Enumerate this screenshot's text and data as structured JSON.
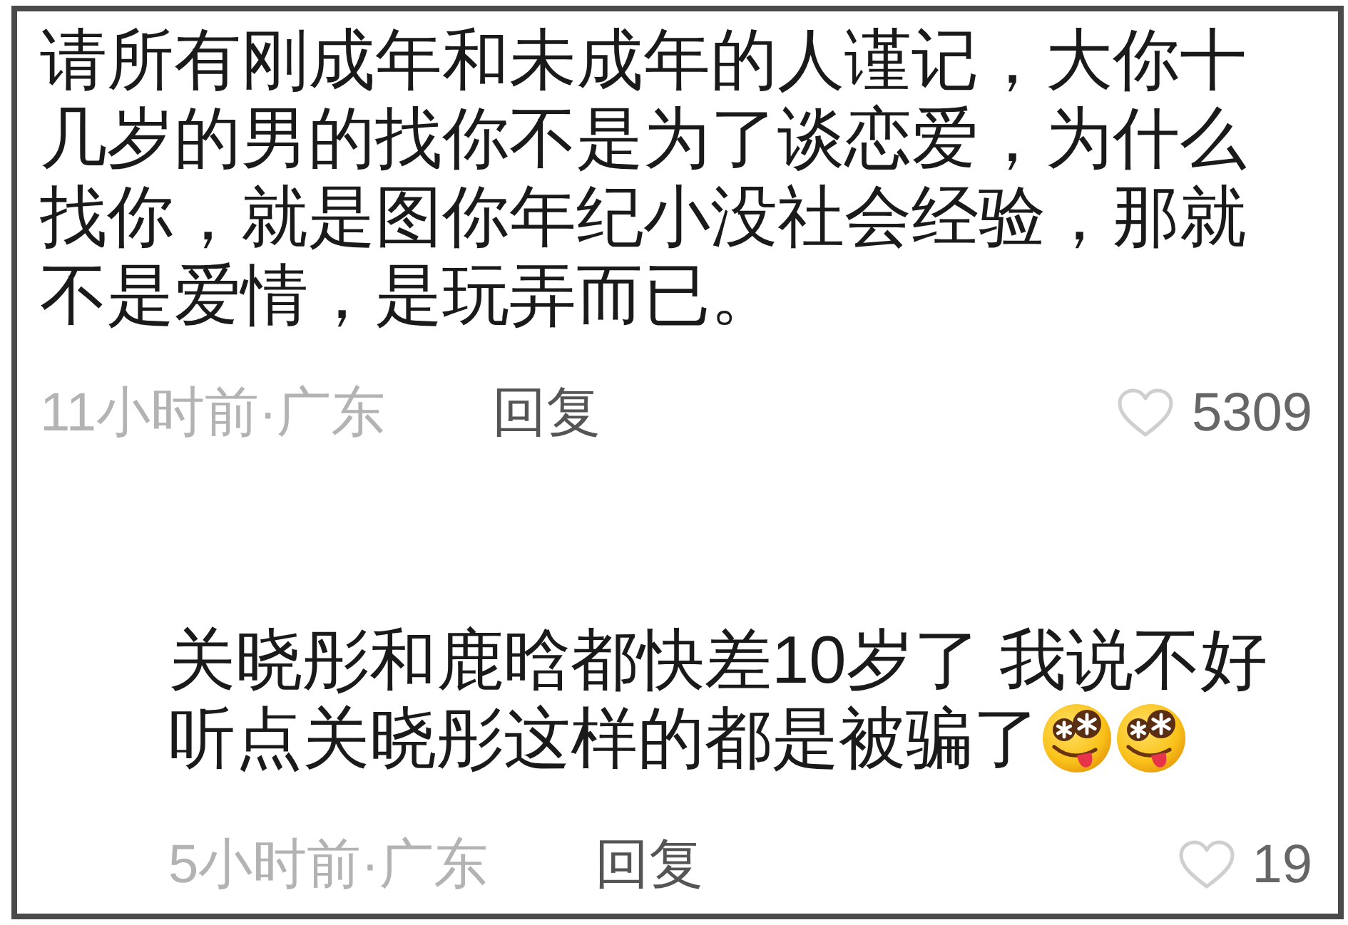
{
  "comments": [
    {
      "kind": "comment",
      "lines": [
        "请所有刚成年和未成年的人谨记，大你十几岁的男的找你不是为了谈恋爱，为什么找你，就是图你年纪小没社会经验，那就不是爱情，是玩弄而已。"
      ],
      "meta": "11小时前·广东",
      "reply": "回复",
      "liked": false,
      "likes": "5309"
    },
    {
      "kind": "reply",
      "lines": [
        "关晓彤和鹿晗都快差10岁了 我说不好",
        "听点关晓彤这样的都是被骗了"
      ],
      "emojis": [
        {
          "kind": "star-eyes-tongue"
        },
        {
          "kind": "star-eyes-tongue"
        }
      ],
      "meta": "5小时前·广东",
      "reply": "回复",
      "liked": false,
      "likes": "19"
    }
  ]
}
